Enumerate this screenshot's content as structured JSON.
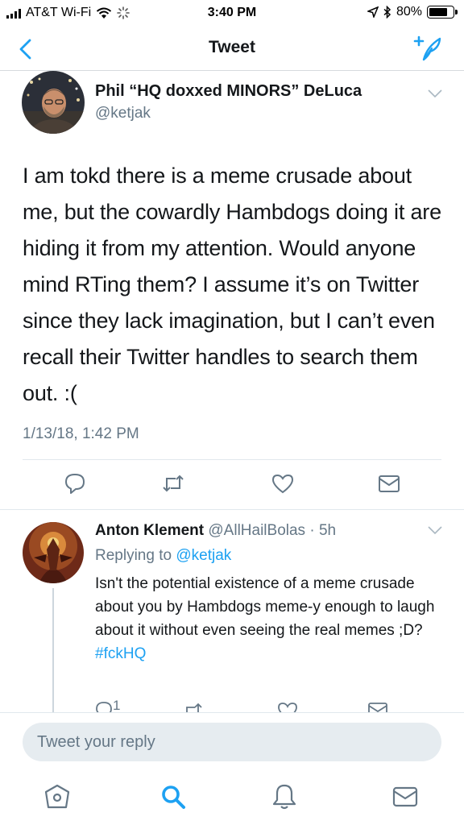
{
  "status_bar": {
    "carrier": "AT&T Wi-Fi",
    "time": "3:40 PM",
    "battery": "80%",
    "battery_level": 0.8
  },
  "nav": {
    "title": "Tweet",
    "back_icon": "chevron-left-icon",
    "compose_icon": "compose-tweet-icon"
  },
  "main_tweet": {
    "author_name": "Phil “HQ doxxed MINORS” DeLuca",
    "handle": "@ketjak",
    "text": "I am tokd there is a meme crusade about me, but the cowardly Hambdogs doing it are hiding it from my attention. Would anyone mind RTing them? I assume it’s on Twitter since they lack imagination, but I can’t even recall their Twitter handles to search them out. :(",
    "timestamp": "1/13/18, 1:42 PM",
    "actions": [
      "reply-icon",
      "retweet-icon",
      "like-icon",
      "direct-message-icon"
    ]
  },
  "reply": {
    "author_name": "Anton Klement",
    "handle": "@AllHailBolas",
    "separator": "·",
    "age": "5h",
    "replying_prefix": "Replying to",
    "replying_to": "@ketjak",
    "text": "Isn't the potential existence of a meme crusade  about you by Hambdogs meme-y enough to laugh about it without even seeing the real memes ;D?",
    "hashtag": "#fckHQ",
    "reply_count": "1"
  },
  "composer": {
    "placeholder": "Tweet your reply"
  },
  "tab_bar": {
    "items": [
      "home-icon",
      "search-icon",
      "notifications-icon",
      "messages-icon"
    ],
    "active": "search-icon"
  },
  "colors": {
    "accent": "#1da1f2",
    "secondary_text": "#657786",
    "primary_text": "#14171a",
    "divider": "#e1e8ed",
    "input_bg": "#e6ecf0"
  }
}
